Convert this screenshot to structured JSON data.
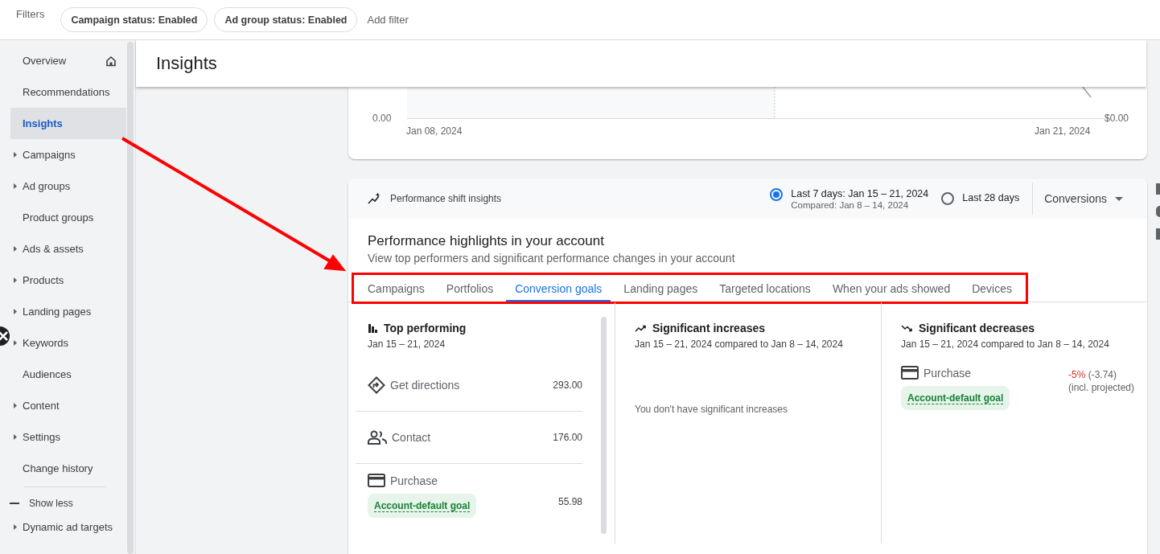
{
  "filters": {
    "label": "Filters",
    "chips": [
      "Campaign status: Enabled",
      "Ad group status: Enabled"
    ],
    "add_filter": "Add filter"
  },
  "sidebar": {
    "items": [
      {
        "label": "Overview",
        "expandable": false,
        "selected": false,
        "kind": "home"
      },
      {
        "label": "Recommendations",
        "expandable": false,
        "selected": false,
        "kind": "plain"
      },
      {
        "label": "Insights",
        "expandable": false,
        "selected": true,
        "kind": "plain"
      },
      {
        "label": "Campaigns",
        "expandable": true,
        "selected": false,
        "kind": "plain"
      },
      {
        "label": "Ad groups",
        "expandable": true,
        "selected": false,
        "kind": "plain"
      },
      {
        "label": "Product groups",
        "expandable": false,
        "selected": false,
        "kind": "plain"
      },
      {
        "label": "Ads & assets",
        "expandable": true,
        "selected": false,
        "kind": "plain"
      },
      {
        "label": "Products",
        "expandable": true,
        "selected": false,
        "kind": "plain"
      },
      {
        "label": "Landing pages",
        "expandable": true,
        "selected": false,
        "kind": "plain"
      },
      {
        "label": "Keywords",
        "expandable": true,
        "selected": false,
        "kind": "plain"
      },
      {
        "label": "Audiences",
        "expandable": false,
        "selected": false,
        "kind": "plain"
      },
      {
        "label": "Content",
        "expandable": true,
        "selected": false,
        "kind": "plain"
      },
      {
        "label": "Settings",
        "expandable": true,
        "selected": false,
        "kind": "plain"
      },
      {
        "label": "Change history",
        "expandable": false,
        "selected": false,
        "kind": "plain"
      }
    ],
    "show_less": "Show less",
    "more_items": [
      {
        "label": "Dynamic ad targets",
        "expandable": true
      }
    ]
  },
  "page_title": "Insights",
  "trend_chart": {
    "left_axis_label": "0.00",
    "right_axis_label": "$0.00",
    "x_start": "Jan 08, 2024",
    "x_end": "Jan 21, 2024"
  },
  "performance_card": {
    "title": "Performance shift insights",
    "date_options": [
      {
        "label": "Last 7 days: Jan 15 – 21, 2024",
        "sublabel": "Compared: Jan 8 – 14, 2024",
        "selected": true
      },
      {
        "label": "Last 28 days",
        "selected": false
      }
    ],
    "metric_dropdown": "Conversions",
    "heading": "Performance highlights in your account",
    "subheading": "View top performers and significant performance changes in your account",
    "tabs": [
      {
        "label": "Campaigns",
        "selected": false
      },
      {
        "label": "Portfolios",
        "selected": false
      },
      {
        "label": "Conversion goals",
        "selected": true
      },
      {
        "label": "Landing pages",
        "selected": false
      },
      {
        "label": "Targeted locations",
        "selected": false
      },
      {
        "label": "When your ads showed",
        "selected": false
      },
      {
        "label": "Devices",
        "selected": false
      }
    ],
    "columns": [
      {
        "kind": "top",
        "title": "Top performing",
        "date": "Jan 15 – 21, 2024",
        "rows": [
          {
            "kind": "directions",
            "label": "Get directions",
            "value": "293.00"
          },
          {
            "kind": "people",
            "label": "Contact",
            "value": "176.00"
          },
          {
            "kind": "card",
            "label": "Purchase",
            "tag": "Account-default goal",
            "value": "55.98"
          }
        ]
      },
      {
        "kind": "increases",
        "title": "Significant increases",
        "date": "Jan 15 – 21, 2024 compared to Jan 8 – 14, 2024",
        "empty_message": "You don't have significant increases"
      },
      {
        "kind": "decreases",
        "title": "Significant decreases",
        "date": "Jan 15 – 21, 2024 compared to Jan 8 – 14, 2024",
        "rows": [
          {
            "kind": "card",
            "label": "Purchase",
            "tag": "Account-default goal",
            "change": "-5%",
            "detail": "(-3.74)",
            "note": "(incl. projected)"
          }
        ]
      }
    ]
  }
}
